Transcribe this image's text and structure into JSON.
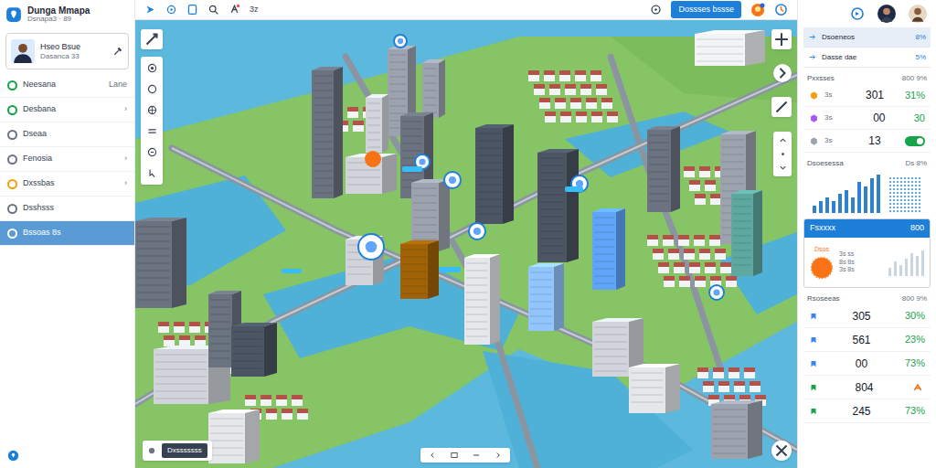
{
  "app": {
    "title": "Dunga Mmapa",
    "subtitle": "Dsnapa3 · 89"
  },
  "user": {
    "name": "Hseo Bsue",
    "role": "Dasanca 33"
  },
  "sidebar": {
    "items": [
      {
        "label": "Neesana",
        "trail": "Lane",
        "selected": false,
        "color": "#16a34a"
      },
      {
        "label": "Desbana",
        "trail": "›",
        "selected": false,
        "color": "#16a34a"
      },
      {
        "label": "Dseaa",
        "trail": "",
        "selected": false,
        "color": "#6b7280"
      },
      {
        "label": "Fenosia",
        "trail": "›",
        "selected": false,
        "color": "#6b7280"
      },
      {
        "label": "Dxssbas",
        "trail": "›",
        "selected": false,
        "color": "#f59e0b"
      },
      {
        "label": "Dsshsss",
        "trail": "",
        "selected": false,
        "color": "#6b7280"
      },
      {
        "label": "Bssoas 8s",
        "trail": "",
        "selected": true,
        "color": "#ffffff"
      }
    ]
  },
  "topbar": {
    "counter": "3z",
    "button": "Dossses bssse"
  },
  "map": {
    "chip": "Dxsssssss"
  },
  "right_panel": {
    "filters": [
      {
        "label": "Dsoeneos",
        "value": "8%",
        "selected": true
      },
      {
        "label": "Dasse dae",
        "value": "5%",
        "selected": false
      }
    ],
    "stats": {
      "title": "Pxxsses",
      "value": "800 9%",
      "rows": [
        {
          "kind": "pct",
          "label": "3s",
          "value": "301",
          "pct": "31%",
          "color": "#f59e0b"
        },
        {
          "kind": "pct",
          "label": "3s",
          "value": "00",
          "pct": "30",
          "color": "#a855f7"
        },
        {
          "kind": "toggle",
          "label": "3s",
          "value": "13",
          "on": true,
          "color": "#9ca3af"
        }
      ]
    },
    "chart": {
      "title": "Dsoesessa",
      "value": "Ds 8%",
      "values": [
        2,
        3,
        4,
        3,
        5,
        6,
        4,
        8,
        7,
        9,
        10
      ]
    },
    "card": {
      "title": "Fsxxxx",
      "value": "800",
      "gauge_label": "Dsos",
      "lines": [
        "3s ss",
        "8s 8s",
        "3s 8s"
      ],
      "meter_values": [
        3,
        5,
        4,
        6,
        8,
        7,
        9
      ]
    },
    "rankings": {
      "title": "Rsoseeas",
      "value": "800 9%",
      "rows": [
        {
          "kind": "pct",
          "value": "305",
          "pct": "30%",
          "color": "#3b82f6"
        },
        {
          "kind": "pct",
          "value": "561",
          "pct": "23%",
          "color": "#3b82f6"
        },
        {
          "kind": "pct",
          "value": "00",
          "pct": "73%",
          "color": "#3b82f6"
        },
        {
          "kind": "tag",
          "value": "804",
          "color": "#16a34a"
        },
        {
          "kind": "pct",
          "value": "245",
          "pct": "73%",
          "color": "#16a34a"
        }
      ]
    }
  }
}
